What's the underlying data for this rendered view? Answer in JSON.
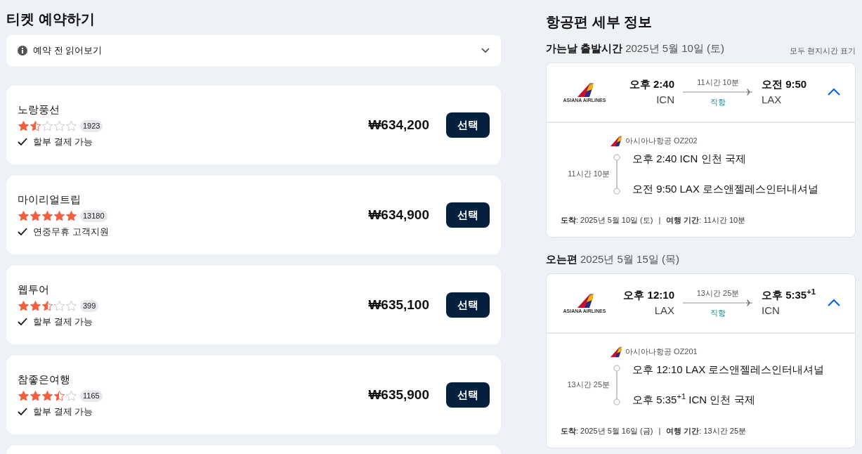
{
  "booking": {
    "title": "티켓 예약하기",
    "notice": "예약 전 읽어보기",
    "notice_expanded": false,
    "offers": [
      {
        "name": "노랑풍선",
        "stars": 1.5,
        "reviews": "1923",
        "feature": "할부 결제 가능",
        "price": "₩634,200",
        "button": "선택"
      },
      {
        "name": "마이리얼트립",
        "stars": 5,
        "reviews": "13180",
        "feature": "연중무휴 고객지원",
        "price": "₩634,900",
        "button": "선택"
      },
      {
        "name": "웹투어",
        "stars": 2.5,
        "reviews": "399",
        "feature": "할부 결제 가능",
        "price": "₩635,100",
        "button": "선택"
      },
      {
        "name": "참좋은여행",
        "stars": 3.5,
        "reviews": "1165",
        "feature": "할부 결제 가능",
        "price": "₩635,900",
        "button": "선택"
      }
    ],
    "more_cards": true
  },
  "details": {
    "title": "항공편 세부 정보",
    "local_time_note": "모두 현지시간 표기",
    "legs": [
      {
        "label": "가는날 출발시간",
        "date": "2025년 5월 10일 (토)",
        "airline_logo_text": "ASIANA AIRLINES",
        "dep_time": "오후 2:40",
        "dep_code": "ICN",
        "duration": "11시간 10분",
        "stops": "직항",
        "arr_time": "오전 9:50",
        "arr_code": "LAX",
        "expanded": true,
        "flight": "아시아나항공 OZ202",
        "segment_duration": "11시간 10분",
        "dep_line": "오후 2:40 ICN 인천 국제",
        "arr_line": "오전 9:50 LAX 로스앤젤레스인터내셔널",
        "arrival": "**도착**: 2025년 5월 10일 (토)",
        "separator": "|",
        "total": "**여행 기간**: 11시간 10분"
      },
      {
        "label": "오는편",
        "date": "2025년 5월 15일 (목)",
        "airline_logo_text": "ASIANA AIRLINES",
        "dep_time": "오후 12:10",
        "dep_code": "LAX",
        "duration": "13시간 25분",
        "stops": "직항",
        "arr_time": "오후 5:35$^{+1}$",
        "arr_code": "ICN",
        "expanded": true,
        "flight": "아시아나항공 OZ201",
        "segment_duration": "13시간 25분",
        "dep_line": "오후 12:10 LAX 로스앤젤레스인터내셔널",
        "arr_line": "오후 5:35$^{+1}$ ICN 인천 국제",
        "arrival": "**도착**: 2025년 5월 16일 (금)",
        "separator": "|",
        "total": "**여행 기간**: 13시간 25분"
      }
    ]
  }
}
